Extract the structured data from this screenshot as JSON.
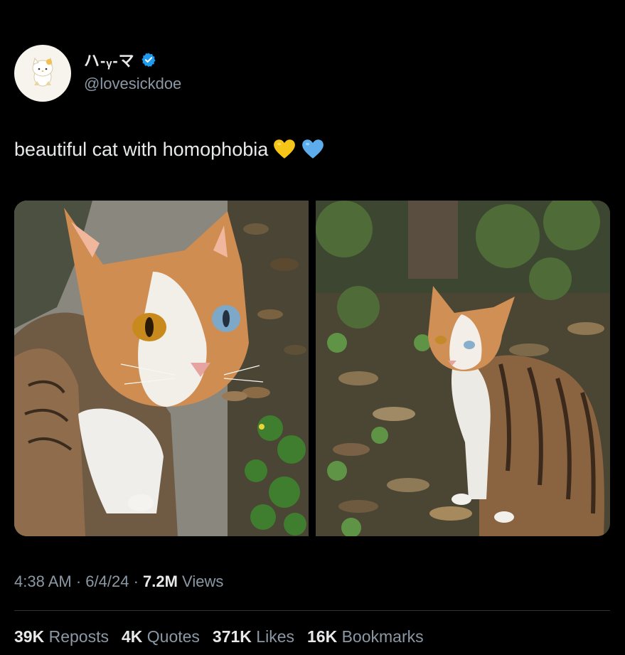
{
  "author": {
    "display_name": "ハ-ᵧ-マ",
    "handle": "@lovesickdoe",
    "avatar_icon": "hello-kitty-avatar",
    "verified_icon": "verified-badge-icon",
    "verified_color": "#1d9bf0"
  },
  "tweet": {
    "text": "beautiful cat with homophobia",
    "emojis": [
      "yellow-heart",
      "blue-heart"
    ],
    "emoji_colors": [
      "#f5c518",
      "#5dadec"
    ]
  },
  "media": {
    "images": [
      "calico-cat-closeup-photo",
      "calico-cat-garden-photo"
    ]
  },
  "meta": {
    "time": "4:38 AM",
    "sep1": " · ",
    "date": "6/4/24",
    "sep2": " · ",
    "views_count": "7.2M",
    "views_label": " Views"
  },
  "stats": {
    "reposts_count": "39K",
    "reposts_label": "Reposts",
    "quotes_count": "4K",
    "quotes_label": "Quotes",
    "likes_count": "371K",
    "likes_label": "Likes",
    "bookmarks_count": "16K",
    "bookmarks_label": "Bookmarks"
  },
  "colors": {
    "background": "#000000",
    "text_primary": "#e7e9ea",
    "text_secondary": "#8b98a5"
  }
}
